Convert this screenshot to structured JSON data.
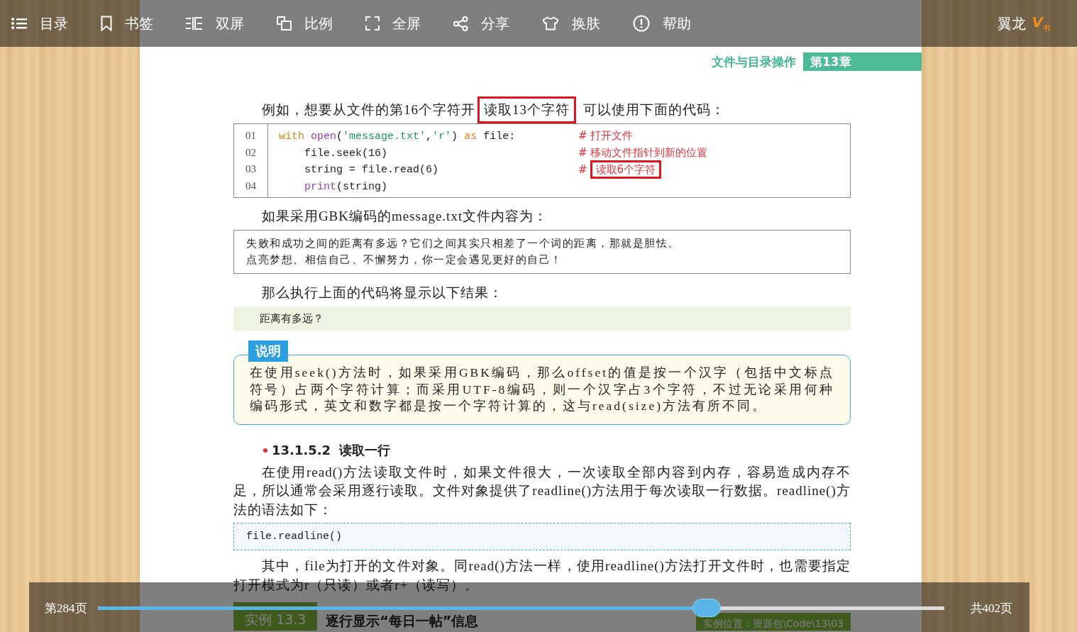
{
  "toolbar": {
    "items": [
      {
        "label": "目录"
      },
      {
        "label": "书签"
      },
      {
        "label": "双屏"
      },
      {
        "label": "比例"
      },
      {
        "label": "全屏"
      },
      {
        "label": "分享"
      },
      {
        "label": "换肤"
      },
      {
        "label": "帮助"
      }
    ],
    "user": "翼龙",
    "logo": "V$_{书}$"
  },
  "page_header": {
    "section": "文件与目录操作",
    "chapter": "第13章"
  },
  "content": [
    {
      "kind": "paragraph",
      "parts": [
        {
          "text": "例如，想要从文件的第16个字符开",
          "boxed": false
        },
        {
          "text": "读取13个字符",
          "boxed": true
        },
        {
          "text": "可以使用下面的代码：",
          "boxed": false
        }
      ]
    },
    {
      "kind": "code",
      "lines": [
        {
          "number": "01",
          "tokens": [
            {
              "text": "with",
              "kind": "keyword"
            },
            {
              "text": " open",
              "kind": "builtin"
            },
            {
              "text": "(",
              "kind": "plain"
            },
            {
              "text": "'message.txt'",
              "kind": "string"
            },
            {
              "text": ",",
              "kind": "plain"
            },
            {
              "text": "'r'",
              "kind": "string"
            },
            {
              "text": ") ",
              "kind": "plain"
            },
            {
              "text": "as",
              "kind": "keyword"
            },
            {
              "text": " file:",
              "kind": "plain"
            }
          ],
          "comment": [
            {
              "text": "# 打开文件",
              "boxed": false
            }
          ]
        },
        {
          "number": "02",
          "tokens": [
            {
              "text": "    file.seek(16)",
              "kind": "plain"
            }
          ],
          "comment": [
            {
              "text": "# 移动文件指针到新的位置",
              "boxed": false
            }
          ]
        },
        {
          "number": "03",
          "tokens": [
            {
              "text": "    string = file.read(6)",
              "kind": "plain"
            }
          ],
          "comment": [
            {
              "text": "#",
              "boxed": false
            },
            {
              "text": "读取6个字符",
              "boxed": true
            }
          ]
        },
        {
          "number": "04",
          "tokens": [
            {
              "text": "    print",
              "kind": "builtin"
            },
            {
              "text": "(string)",
              "kind": "plain"
            }
          ]
        }
      ]
    },
    {
      "kind": "paragraph",
      "parts": [
        {
          "text": "如果采用GBK编码的message.txt文件内容为：",
          "boxed": false
        }
      ]
    },
    {
      "kind": "text_box",
      "lines": [
        "失败和成功之间的距离有多远？它们之间其实只相差了一个词的距离，那就是胆怯。",
        "点亮梦想、相信自己、不懈努力，你一定会遇见更好的自己！"
      ]
    },
    {
      "kind": "paragraph",
      "parts": [
        {
          "text": "那么执行上面的代码将显示以下结果：",
          "boxed": false
        }
      ]
    },
    {
      "kind": "output",
      "text": "距离有多远？"
    },
    {
      "kind": "note",
      "label": "说明",
      "text": "在使用seek()方法时，如果采用GBK编码，那么offset的值是按一个汉字（包括中文标点符号）占两个字符计算；而采用UTF-8编码，则一个汉字占3个字符，不过无论采用何种编码形式，英文和数字都是按一个字符计算的，这与read(size)方法有所不同。"
    },
    {
      "kind": "heading",
      "number": "13.1.5.2",
      "title": "读取一行"
    },
    {
      "kind": "paragraph",
      "parts": [
        {
          "text": "在使用read()方法读取文件时，如果文件很大，一次读取全部内容到内存，容易造成内存不足，所以通常会采用逐行读取。文件对象提供了readline()方法用于每次读取一行数据。readline()方法的语法如下：",
          "boxed": false
        }
      ]
    },
    {
      "kind": "code_box",
      "lines": [
        "file.readline()"
      ]
    },
    {
      "kind": "paragraph",
      "parts": [
        {
          "text": "其中，file为打开的文件对象。同read()方法一样，使用readline()方法打开文件时，也需要指定打开模式为r（只读）或者r+（读写）。",
          "boxed": false
        }
      ]
    },
    {
      "kind": "example",
      "label": "实例 13.3",
      "title": "逐行显示“每日一帖”信息",
      "location": "实例位置：资源包\\Code\\13\\03"
    }
  ],
  "pager": {
    "current": "第284页",
    "total": "共402页",
    "level": 0.72
  }
}
